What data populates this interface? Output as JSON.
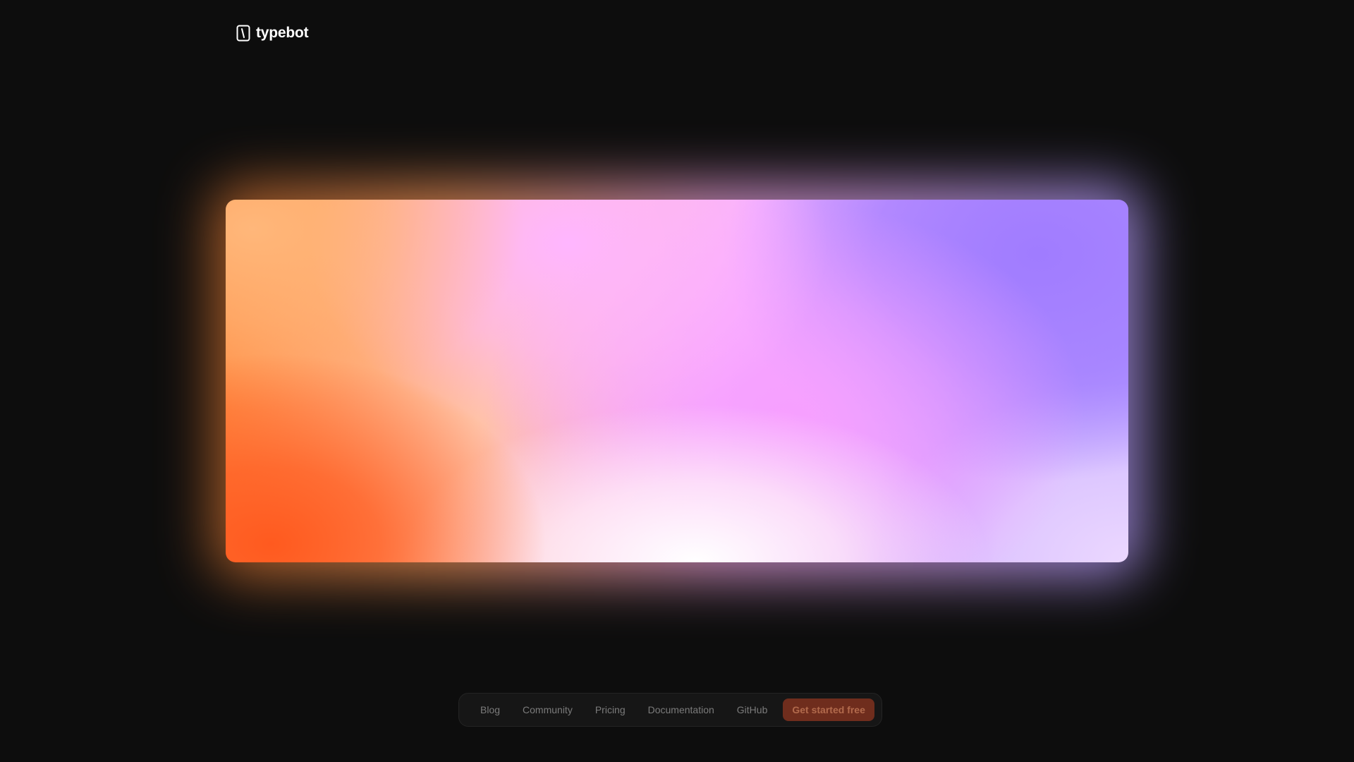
{
  "brand": {
    "name": "typebot",
    "icon": "typebot-logo-icon"
  },
  "hero": {
    "colors": {
      "orange": "#ff5a1f",
      "peach": "#ffb77a",
      "pink": "#f7a0ff",
      "violet": "#a07cff",
      "white": "#ffffff"
    }
  },
  "nav": {
    "items": [
      {
        "label": "Blog"
      },
      {
        "label": "Community"
      },
      {
        "label": "Pricing"
      },
      {
        "label": "Documentation"
      },
      {
        "label": "GitHub"
      }
    ],
    "cta_label": "Get started free",
    "cta_color": "#6f2d1d"
  },
  "colors": {
    "background": "#0d0d0d",
    "nav_background": "#161616",
    "nav_text": "#7b7b7b"
  }
}
